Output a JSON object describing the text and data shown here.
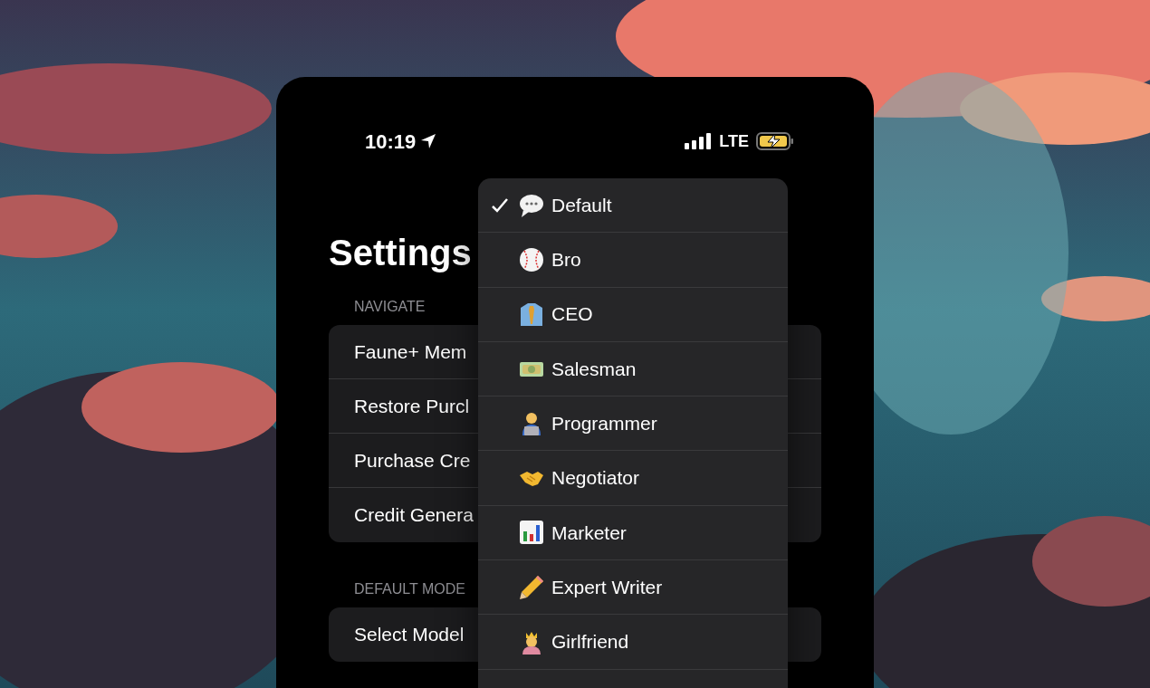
{
  "status_bar": {
    "time": "10:19",
    "network": "LTE"
  },
  "title": "Settings",
  "sections": [
    {
      "header": "NAVIGATE",
      "rows": [
        "Faune+ Mem",
        "Restore Purcl",
        "Purchase Cre",
        "Credit Genera"
      ]
    },
    {
      "header": "DEFAULT MODE",
      "rows": [
        "Select Model"
      ]
    }
  ],
  "menu": [
    {
      "label": "Default",
      "selected": true
    },
    {
      "label": "Bro",
      "selected": false
    },
    {
      "label": "CEO",
      "selected": false
    },
    {
      "label": "Salesman",
      "selected": false
    },
    {
      "label": "Programmer",
      "selected": false
    },
    {
      "label": "Negotiator",
      "selected": false
    },
    {
      "label": "Marketer",
      "selected": false
    },
    {
      "label": "Expert Writer",
      "selected": false
    },
    {
      "label": "Girlfriend",
      "selected": false
    }
  ]
}
